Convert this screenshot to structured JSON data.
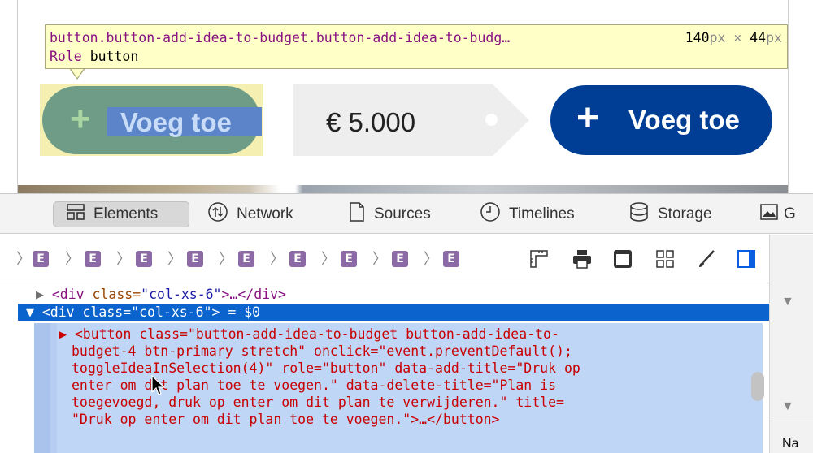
{
  "tooltip": {
    "selector": "button.button-add-idea-to-budget.button-add-idea-to-budg…",
    "width_num": "140",
    "unit_a": "px",
    "times": " × ",
    "height_num": "44",
    "unit_b": "px",
    "role_key": "Role",
    "role_value": "button"
  },
  "page": {
    "highlight_button_label": "Voeg toe",
    "price": "€ 5.000",
    "add_button_label": "Voeg toe",
    "plus_glyph": "+"
  },
  "tabs": [
    {
      "label": "Elements",
      "icon": "elements-icon"
    },
    {
      "label": "Network",
      "icon": "network-icon"
    },
    {
      "label": "Sources",
      "icon": "sources-icon"
    },
    {
      "label": "Timelines",
      "icon": "timelines-icon"
    },
    {
      "label": "Storage",
      "icon": "storage-icon"
    },
    {
      "label": "G",
      "icon": "graphics-icon"
    }
  ],
  "breadcrumb": {
    "items": [
      "E",
      "E",
      "E",
      "E",
      "E",
      "E",
      "E",
      "E",
      "E"
    ]
  },
  "dom": {
    "row1": {
      "arrow": "▶",
      "open": "<div ",
      "attr": "class=",
      "val": "\"col-xs-6\"",
      "rest": ">…</div>"
    },
    "row2": {
      "arrow": "▼",
      "open": "<div ",
      "attr": "class=",
      "val": "\"col-xs-6\"",
      "rest": "> = $0"
    },
    "child_lines": [
      "▶ <button class=\"button-add-idea-to-budget button-add-idea-to-",
      "budget-4 btn-primary stretch\" onclick=\"event.preventDefault();",
      "toggleIdeaInSelection(4)\" role=\"button\" data-add-title=\"Druk op",
      "enter om dit plan toe te voegen.\" data-delete-title=\"Plan is",
      "toegevoegd, druk op enter om dit plan te verwijderen.\" title=",
      "\"Druk op enter om dit plan toe te voegen.\">…</button>"
    ]
  },
  "sidebar": {
    "label": "Na"
  },
  "colors": {
    "accent_blue": "#003e96",
    "selection_blue": "#0b63ce",
    "tag_purple": "#881280",
    "tooltip_yellow": "#ffffc8"
  }
}
